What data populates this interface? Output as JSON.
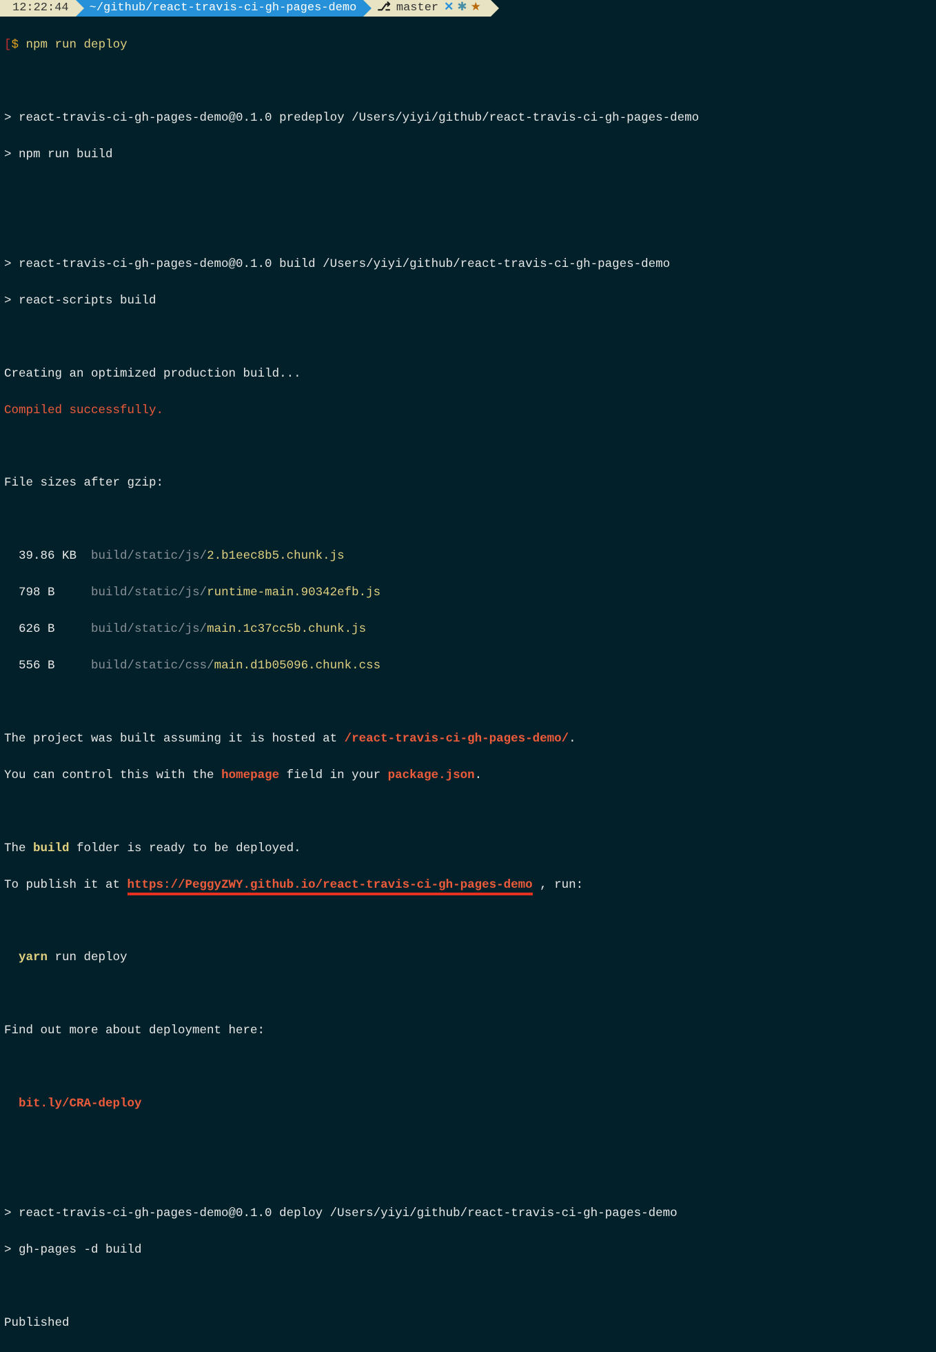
{
  "prompt": {
    "time": "12:22:44",
    "path": "~/github/react-travis-ci-gh-pages-demo",
    "branch": "master",
    "dollar": "$",
    "command": "npm run deploy"
  },
  "output": {
    "predeploy_line": "> react-travis-ci-gh-pages-demo@0.1.0 predeploy /Users/yiyi/github/react-travis-ci-gh-pages-demo",
    "predeploy_cmd": "> npm run build",
    "build_line": "> react-travis-ci-gh-pages-demo@0.1.0 build /Users/yiyi/github/react-travis-ci-gh-pages-demo",
    "build_cmd": "> react-scripts build",
    "creating": "Creating an optimized production build...",
    "compiled": "Compiled successfully.",
    "filesizes_header": "File sizes after gzip:",
    "files": [
      {
        "size": "39.86 KB",
        "pad": "  ",
        "path": "build/static/js/",
        "name": "2.b1eec8b5.chunk.js"
      },
      {
        "size": "798 B",
        "pad": "     ",
        "path": "build/static/js/",
        "name": "runtime-main.90342efb.js"
      },
      {
        "size": "626 B",
        "pad": "     ",
        "path": "build/static/js/",
        "name": "main.1c37cc5b.chunk.js"
      },
      {
        "size": "556 B",
        "pad": "     ",
        "path": "build/static/css/",
        "name": "main.d1b05096.chunk.css"
      }
    ],
    "hosted1_a": "The project was built assuming it is hosted at ",
    "hosted1_b": "/react-travis-ci-gh-pages-demo/",
    "hosted1_c": ".",
    "hosted2_a": "You can control this with the ",
    "hosted2_b": "homepage",
    "hosted2_c": " field in your ",
    "hosted2_d": "package.json",
    "hosted2_e": ".",
    "ready_a": "The ",
    "ready_b": "build",
    "ready_c": " folder is ready to be deployed.",
    "publish_a": "To publish it at ",
    "publish_url": "https://PeggyZWY.github.io/react-travis-ci-gh-pages-demo",
    "publish_c": " , run:",
    "yarn_a": "yarn",
    "yarn_b": " run deploy",
    "findout": "Find out more about deployment here:",
    "bitly": "bit.ly/CRA-deploy",
    "deploy_line": "> react-travis-ci-gh-pages-demo@0.1.0 deploy /Users/yiyi/github/react-travis-ci-gh-pages-demo",
    "deploy_cmd": "> gh-pages -d build",
    "published": "Published"
  }
}
